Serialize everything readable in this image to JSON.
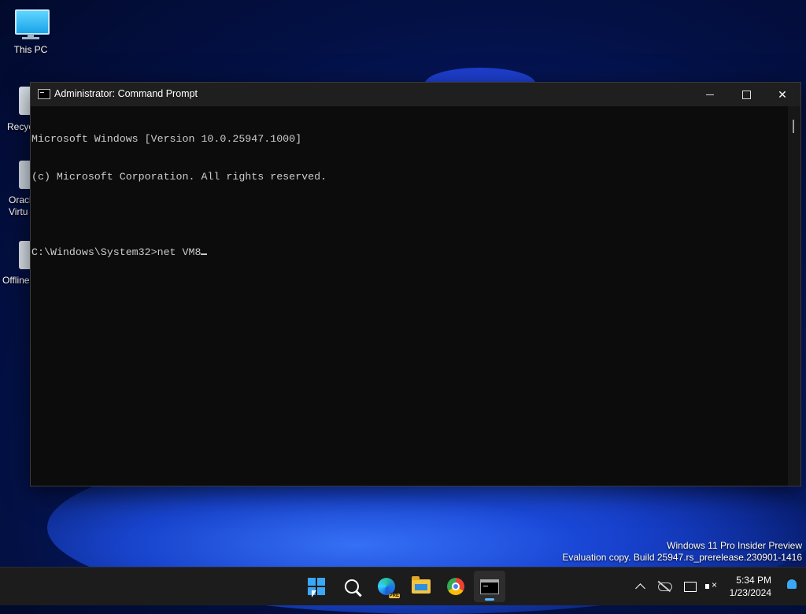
{
  "desktop": {
    "icons": [
      {
        "label": "This PC"
      },
      {
        "label": "Recyc"
      },
      {
        "label": "Oracl\nVirtu"
      },
      {
        "label": "Offline"
      }
    ]
  },
  "window": {
    "title": "Administrator: Command Prompt",
    "controls": {
      "minimize": "minimize",
      "maximize": "maximize",
      "close": "close"
    },
    "console_lines": [
      "Microsoft Windows [Version 10.0.25947.1000]",
      "(c) Microsoft Corporation. All rights reserved.",
      "",
      "C:\\Windows\\System32>net VM8"
    ]
  },
  "watermark": {
    "line1": "Windows 11 Pro Insider Preview",
    "line2": "Evaluation copy. Build 25947.rs_prerelease.230901-1416"
  },
  "taskbar": {
    "apps": [
      {
        "icon": "start-icon"
      },
      {
        "icon": "search-icon"
      },
      {
        "icon": "edge-icon",
        "badge": "PRE"
      },
      {
        "icon": "file-explorer-icon"
      },
      {
        "icon": "chrome-icon"
      },
      {
        "icon": "command-prompt-icon",
        "active": true
      }
    ],
    "clock": {
      "time": "5:34 PM",
      "date": "1/23/2024"
    }
  }
}
